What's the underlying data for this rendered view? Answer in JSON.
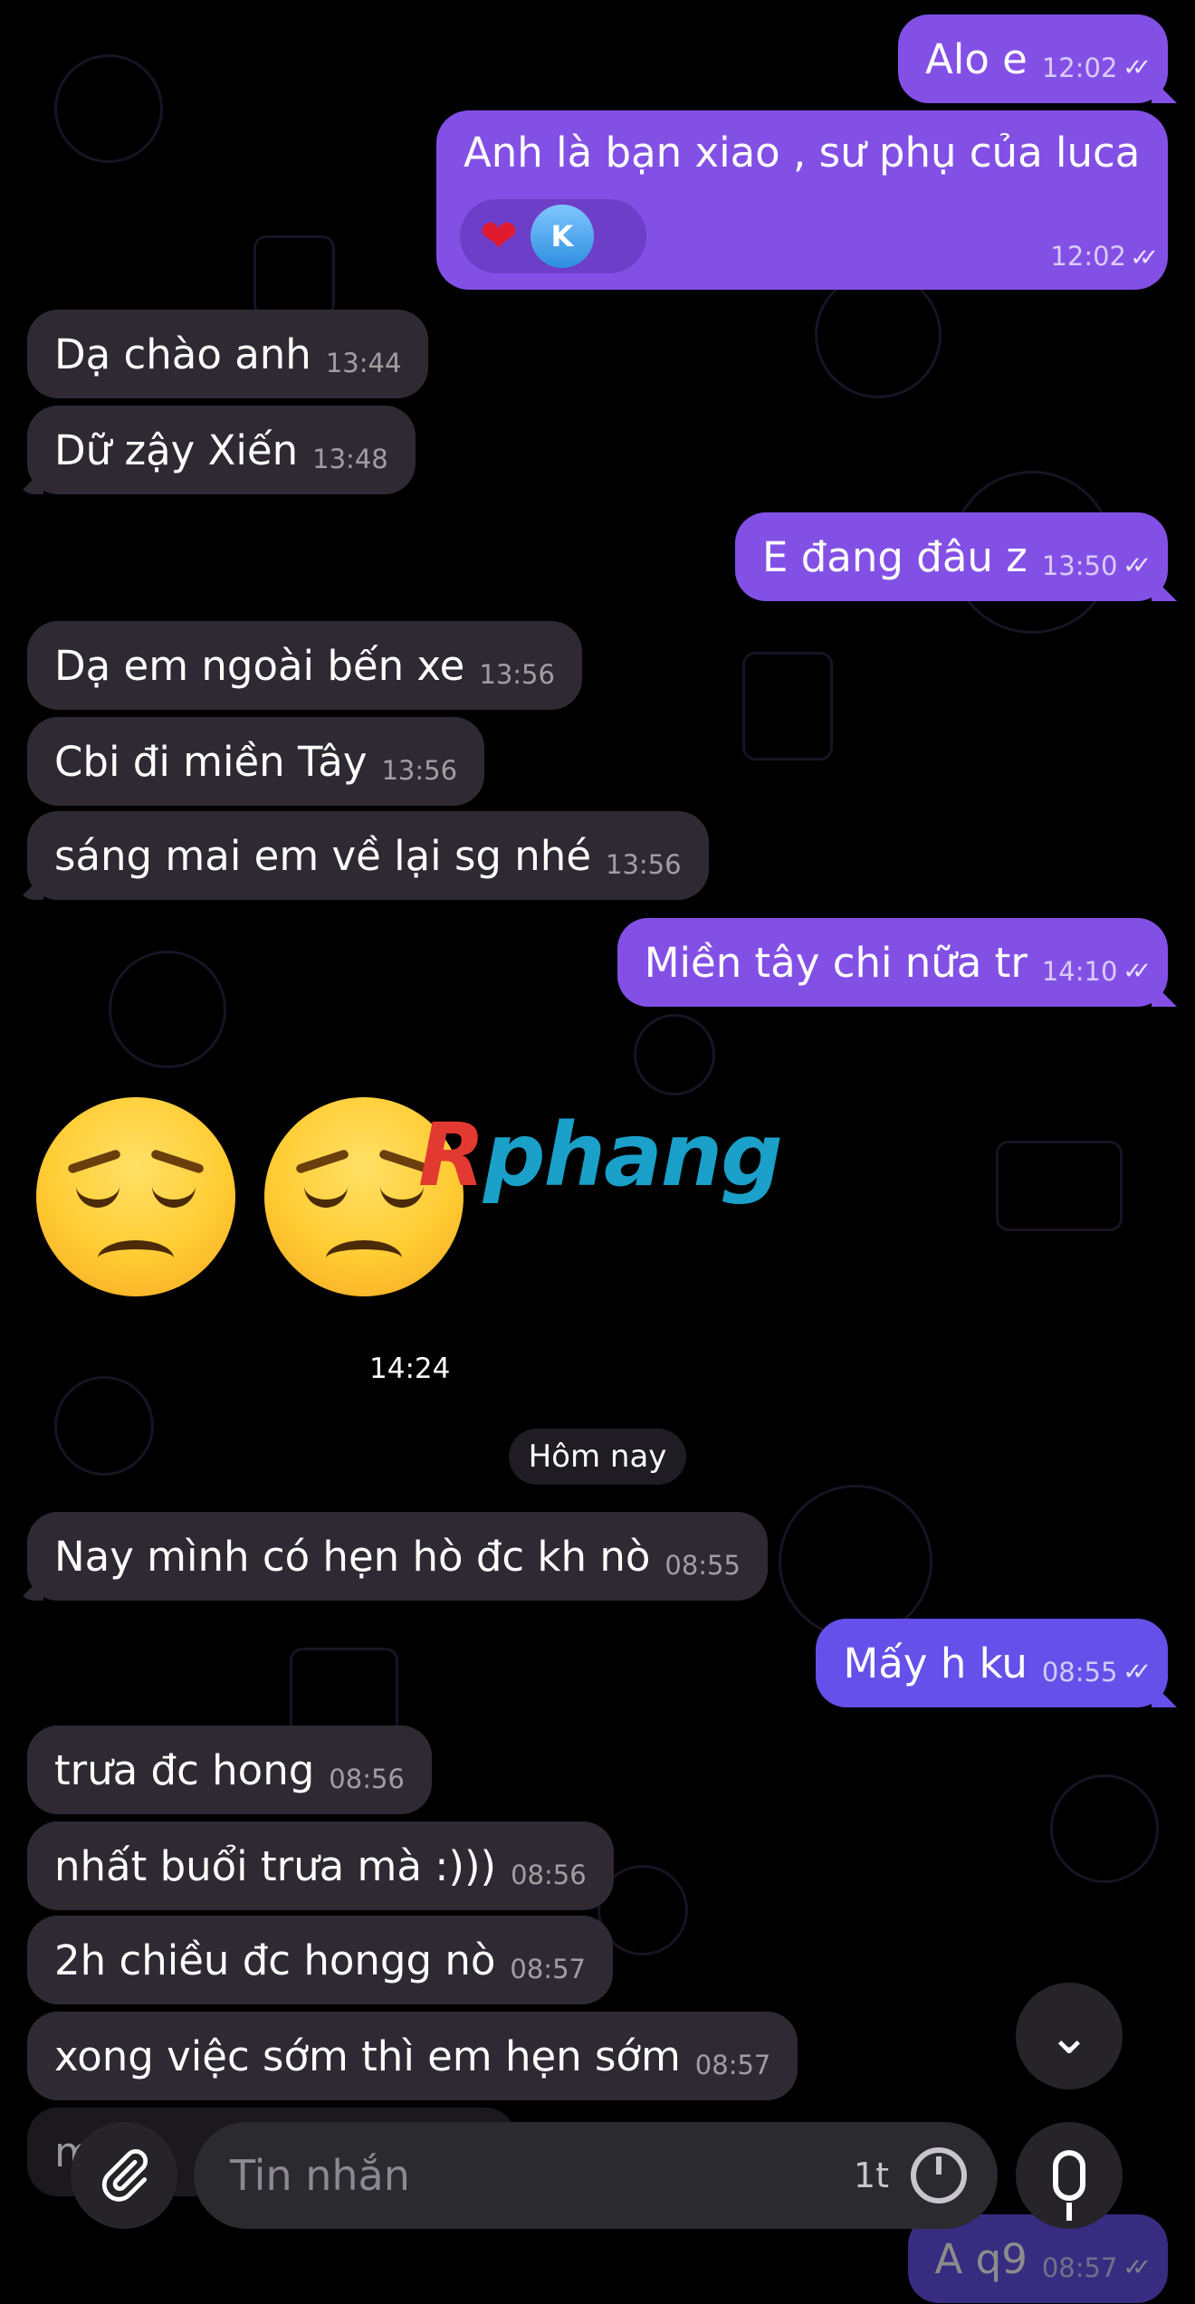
{
  "messages": [
    {
      "dir": "out",
      "text": "Alo e",
      "time": "12:02",
      "ticks": "✓✓"
    },
    {
      "dir": "in",
      "text": "Dạ chào anh",
      "time": "13:44"
    },
    {
      "dir": "in",
      "text": "Dữ zậy Xiến",
      "time": "13:48"
    },
    {
      "dir": "out",
      "text": "E đang đâu z",
      "time": "13:50",
      "ticks": "✓✓"
    },
    {
      "dir": "in",
      "text": "Dạ em ngoài bến xe",
      "time": "13:56"
    },
    {
      "dir": "in",
      "text": "Cbi đi miền Tây",
      "time": "13:56"
    },
    {
      "dir": "in",
      "text": "sáng mai em về lại sg nhé",
      "time": "13:56"
    },
    {
      "dir": "out",
      "text": "Miền tây chi nữa tr",
      "time": "14:10",
      "ticks": "✓✓"
    },
    {
      "dir": "in",
      "text": "Nay mình có hẹn hò đc kh nò",
      "time": "08:55"
    },
    {
      "dir": "out",
      "text": "Mấy h ku",
      "time": "08:55",
      "ticks": "✓✓"
    },
    {
      "dir": "in",
      "text": "trưa đc hong",
      "time": "08:56"
    },
    {
      "dir": "in",
      "text": "nhất buổi trưa mà :)))",
      "time": "08:56"
    },
    {
      "dir": "in",
      "text": "2h chiều đc hongg nò",
      "time": "08:57"
    },
    {
      "dir": "in",
      "text": "xong việc sớm thì em hẹn sớm",
      "time": "08:57"
    },
    {
      "dir": "out",
      "text": "A q9",
      "time": "08:57",
      "ticks": "✓✓"
    }
  ],
  "reaction_message": {
    "text": "Anh là bạn xiao , sư phụ của luca",
    "time": "12:02",
    "ticks": "✓✓",
    "reaction_heart": "❤",
    "reaction_avatar_letter": "K"
  },
  "emoji_message": {
    "time": "14:24",
    "emoji_name": "disappointed-face-emoji"
  },
  "date_separator": "Hôm nay",
  "partial_message": "m",
  "watermark": {
    "first": "R",
    "rest": "phang"
  },
  "input_bar": {
    "placeholder": "Tin nhắn",
    "timer_label": "1t",
    "attach_icon": "paperclip-icon",
    "mic_icon": "microphone-icon",
    "scroll_icon": "chevron-down-icon",
    "scroll_glyph": "⌄",
    "attach_glyph": "🖇"
  },
  "colors": {
    "outgoing": "#8350e6",
    "incoming": "#2e2932",
    "background": "#000000"
  }
}
